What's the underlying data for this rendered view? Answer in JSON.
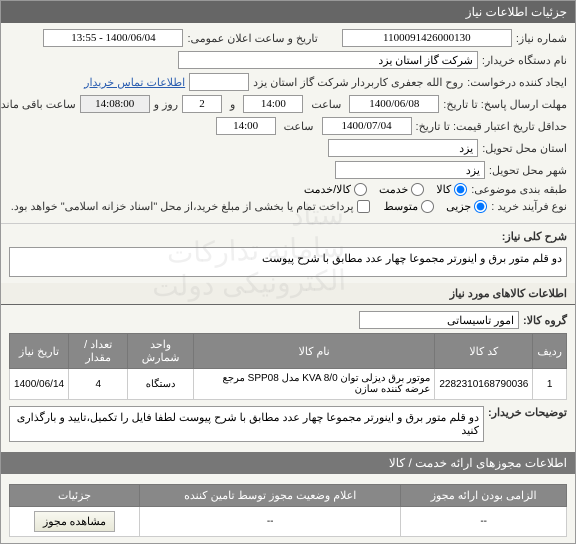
{
  "header": {
    "title": "جزئیات اطلاعات نیاز"
  },
  "fields": {
    "need_no_label": "شماره نیاز:",
    "need_no": "1100091426000130",
    "public_dt_label": "تاریخ و ساعت اعلان عمومی:",
    "public_dt": "1400/06/04 - 13:55",
    "buyer_org_label": "نام دستگاه خریدار:",
    "buyer_org": "شرکت گاز استان یزد",
    "requester_label": "ایجاد کننده درخواست:",
    "requester": "روح الله جعفری کاربردار شرکت گاز استان یزد",
    "contact_link": "اطلاعات تماس خریدار",
    "deadline_label": "مهلت ارسال پاسخ: تا تاریخ:",
    "deadline_date": "1400/06/08",
    "time_label": "ساعت",
    "deadline_time": "14:00",
    "and_label": "و",
    "days": "2",
    "days_unit": "روز و",
    "remaining": "14:08:00",
    "remaining_label": "ساعت باقی مانده",
    "min_valid_label": "حداقل تاریخ اعتبار قیمت: تا تاریخ:",
    "min_valid_date": "1400/07/04",
    "min_valid_time": "14:00",
    "city_deliver_label": "استان محل تحویل:",
    "city_deliver": "یزد",
    "city_deliver2_label": "شهر محل تحویل:",
    "city_deliver2": "یزد",
    "category_label": "طبقه بندی موضوعی:",
    "cat_kala": "کالا",
    "cat_khadamat": "خدمت",
    "cat_kala_khadamat": "کالا/خدمت",
    "purchase_type_label": "نوع فرآیند خرید :",
    "pt_jozi": "جزیی",
    "pt_motevaset": "متوسط",
    "pay_note": "پرداخت تمام یا بخشی از مبلغ خرید،از محل \"اسناد خزانه اسلامی\" خواهد بود."
  },
  "summary": {
    "label": "شرح کلی نیاز:",
    "text": "دو قلم متور برق و اینورتر مجموعا چهار عدد مطابق با شرح پیوست"
  },
  "goods_header": "اطلاعات کالاهای مورد نیاز",
  "group": {
    "label": "گروه کالا:",
    "value": "امور تاسیساتی"
  },
  "table": {
    "cols": [
      "ردیف",
      "کد کالا",
      "نام کالا",
      "واحد شمارش",
      "تعداد / مقدار",
      "تاریخ نیاز"
    ],
    "rows": [
      {
        "idx": "1",
        "code": "2282310168790036",
        "name": "موتور برق دیزلی توان KVA 8/0 مدل SPP08 مرجع عرضه کننده سازن",
        "unit": "دستگاه",
        "qty": "4",
        "date": "1400/06/14"
      }
    ]
  },
  "buyer_notes": {
    "label": "توضیحات خریدار:",
    "text": "دو قلم متور برق و اینورتر مجموعا چهار عدد مطابق با شرح پیوست لطفا فایل را تکمیل،تایید و بارگذاری کنید"
  },
  "bottom": {
    "title": "اطلاعات مجوزهای ارائه خدمت / کالا",
    "cols": [
      "الزامی بودن ارائه مجوز",
      "اعلام وضعیت مجوز توسط تامین کننده",
      "جزئیات"
    ],
    "row": {
      "req": "--",
      "status": "--",
      "btn": "مشاهده مجوز"
    }
  }
}
